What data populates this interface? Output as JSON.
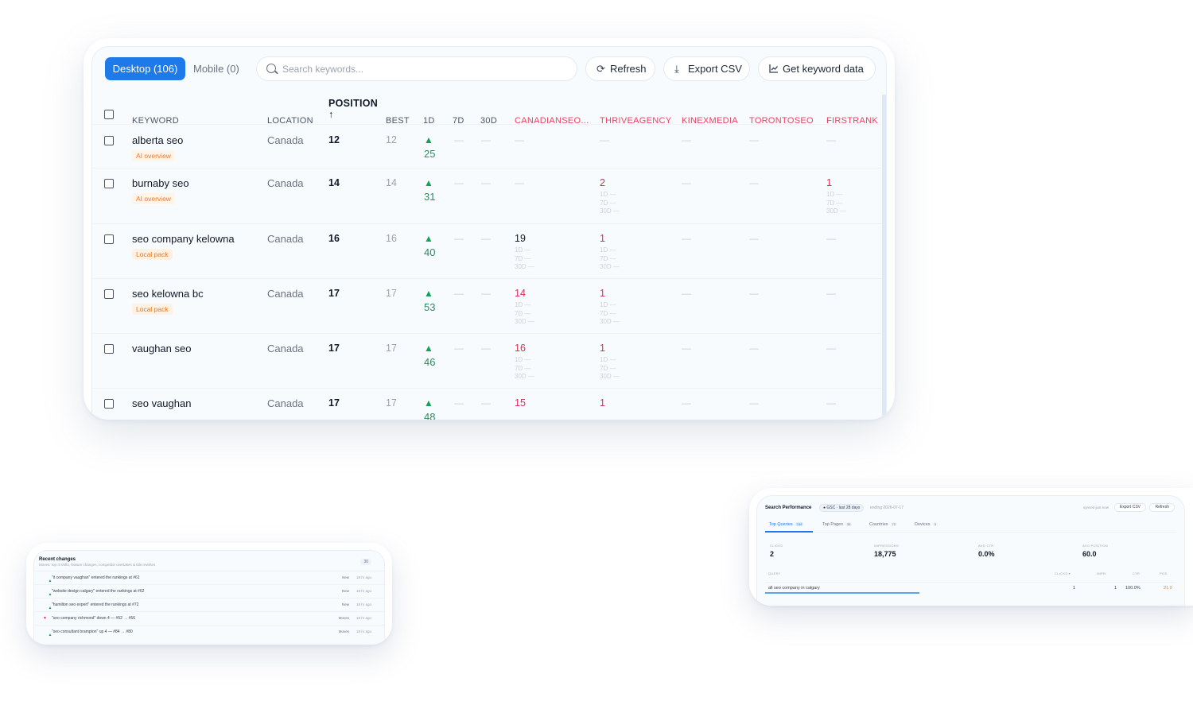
{
  "main": {
    "tabs": {
      "desktop": "Desktop (106)",
      "mobile": "Mobile (0)"
    },
    "search": {
      "placeholder": "Search keywords..."
    },
    "buttons": {
      "refresh": "Refresh",
      "export": "Export CSV",
      "get_data": "Get keyword data"
    },
    "columns": {
      "keyword": "KEYWORD",
      "location": "LOCATION",
      "position": "POSITION",
      "position_sort": "↑",
      "best": "BEST",
      "d1": "1D",
      "d7": "7D",
      "d30": "30D",
      "comp1": "CANADIANSEO...",
      "comp2": "THRIVEAGENCY",
      "comp3": "KINEXMEDIA",
      "comp4": "TORONTOSEO",
      "comp5": "FIRSTRANK"
    },
    "dash": "—",
    "rows": [
      {
        "keyword": "alberta seo",
        "badge": "AI overview",
        "location": "Canada",
        "position": "12",
        "best": "12",
        "up": "25"
      },
      {
        "keyword": "burnaby seo",
        "badge": "AI overview",
        "location": "Canada",
        "position": "14",
        "best": "14",
        "up": "31",
        "comp2": "2",
        "comp5": "1"
      },
      {
        "keyword": "seo company kelowna",
        "badge": "Local pack",
        "location": "Canada",
        "position": "16",
        "best": "16",
        "up": "40",
        "comp1": "19",
        "comp2": "1"
      },
      {
        "keyword": "seo kelowna bc",
        "badge": "Local pack",
        "location": "Canada",
        "position": "17",
        "best": "17",
        "up": "53",
        "comp1": "14",
        "comp2": "1"
      },
      {
        "keyword": "vaughan seo",
        "location": "Canada",
        "position": "17",
        "best": "17",
        "up": "46",
        "comp1": "16",
        "comp2": "1"
      },
      {
        "keyword": "seo vaughan",
        "location": "Canada",
        "position": "17",
        "best": "17",
        "up": "48",
        "comp1": "15",
        "comp2": "1"
      }
    ],
    "sub": {
      "d1": "1D —",
      "d7": "7D —",
      "d30": "30D —"
    }
  },
  "recent": {
    "title": "Recent changes",
    "subtitle": "Moves: top-3 shifts, feature changes, competitor overtakes & title rewrites",
    "count": "30",
    "items": [
      {
        "dir": "up",
        "text": "\"it company vaughan\" entered the rankings at #61",
        "tag": "New",
        "time": "18 hr ago"
      },
      {
        "dir": "up",
        "text": "\"website design calgary\" entered the rankings at #62",
        "tag": "New",
        "time": "18 hr ago"
      },
      {
        "dir": "up",
        "text": "\"hamilton seo expert\" entered the rankings at #72",
        "tag": "New",
        "time": "18 hr ago"
      },
      {
        "dir": "down",
        "text": "\"seo company richmond\" down 4 — #52 → #56",
        "tag": "Moves",
        "time": "18 hr ago"
      },
      {
        "dir": "up",
        "text": "\"seo consultant brampton\" up 4 — #84 → #80",
        "tag": "Moves",
        "time": "18 hr ago"
      }
    ]
  },
  "gsc": {
    "title": "Search Performance",
    "chip": "● GSC · last 28 days",
    "ending": "ending 2026-07-17",
    "synced": "synced just now",
    "export": "Export CSV",
    "refresh": "Refresh",
    "tabs": [
      {
        "label": "Top Queries",
        "count": "749"
      },
      {
        "label": "Top Pages",
        "count": "35"
      },
      {
        "label": "Countries",
        "count": "72"
      },
      {
        "label": "Devices",
        "count": "3"
      }
    ],
    "metrics": [
      {
        "label": "CLICKS",
        "value": "2"
      },
      {
        "label": "IMPRESSIONS",
        "value": "18,775"
      },
      {
        "label": "AVG CTR",
        "value": "0.0%"
      },
      {
        "label": "AVG POSITION",
        "value": "60.0"
      }
    ],
    "table": {
      "headers": {
        "query": "QUERY",
        "clicks": "CLICKS ▾",
        "impr": "IMPR.",
        "ctr": "CTR",
        "pos": "POS."
      },
      "row": {
        "query": "all seo company in calgary",
        "clicks": "1",
        "impr": "1",
        "ctr": "100.0%",
        "pos": "21.0"
      }
    }
  }
}
